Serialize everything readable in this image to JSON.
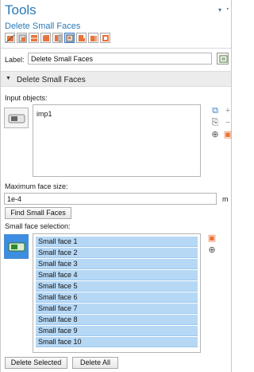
{
  "window": {
    "title": "Tools",
    "subtitle": "Delete Small Faces"
  },
  "toolbar": {
    "tools": [
      {
        "icon": "cut-icon",
        "active": false
      },
      {
        "icon": "delete-face-icon",
        "active": false
      },
      {
        "icon": "merge-faces-icon",
        "active": false
      },
      {
        "icon": "ignore-edges-icon",
        "active": false
      },
      {
        "icon": "collapse-faces-icon",
        "active": false
      },
      {
        "icon": "delete-small-faces-icon",
        "active": true
      },
      {
        "icon": "detach-faces-icon",
        "active": false
      },
      {
        "icon": "fillet-icon",
        "active": false
      },
      {
        "icon": "thin-domain-icon",
        "active": false
      }
    ]
  },
  "label": {
    "caption": "Label:",
    "value": "Delete Small Faces"
  },
  "section": {
    "title": "Delete Small Faces"
  },
  "input_objects": {
    "caption": "Input objects:",
    "items": [
      "imp1"
    ]
  },
  "max_face_size": {
    "caption": "Maximum face size:",
    "value": "1e-4",
    "unit": "m"
  },
  "find_button": {
    "label": "Find Small Faces"
  },
  "small_face_selection": {
    "caption": "Small face selection:",
    "items": [
      "Small face 1",
      "Small face 2",
      "Small face 3",
      "Small face 4",
      "Small face 5",
      "Small face 6",
      "Small face 7",
      "Small face 8",
      "Small face 9",
      "Small face 10"
    ]
  },
  "buttons": {
    "delete_selected": "Delete Selected",
    "delete_all": "Delete All"
  },
  "colors": {
    "accent": "#2a7ab8",
    "selection_highlight": "#b6d8f5",
    "active_selection": "#3d8ee0"
  }
}
